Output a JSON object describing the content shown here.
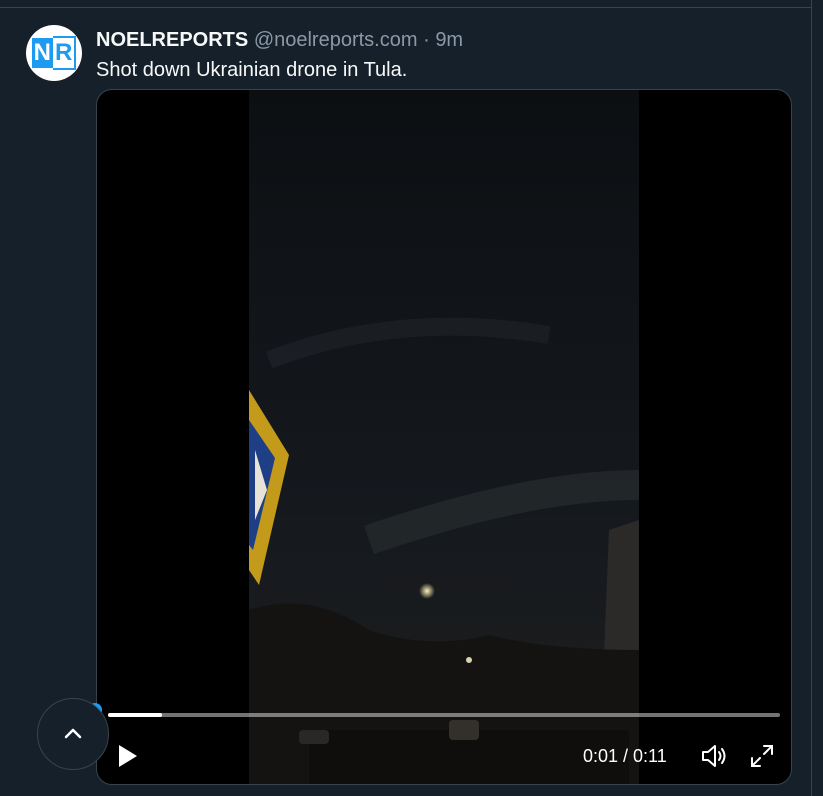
{
  "tweet": {
    "author_name": "NOELREPORTS",
    "handle": "@noelreports.com",
    "separator": "·",
    "time": "9m",
    "text": "Shot down Ukrainian drone in Tula.",
    "avatar_text_left": "N",
    "avatar_text_right": "R"
  },
  "video": {
    "time_display": "0:01 / 0:11",
    "progress_fraction": 0.08
  },
  "icons": {
    "play": "play-icon",
    "volume": "volume-icon",
    "fullscreen": "fullscreen-icon",
    "scroll_top": "chevron-up-icon"
  },
  "colors": {
    "background": "#15202b",
    "accent": "#1d9bf0",
    "muted_text": "#8b98a5"
  }
}
